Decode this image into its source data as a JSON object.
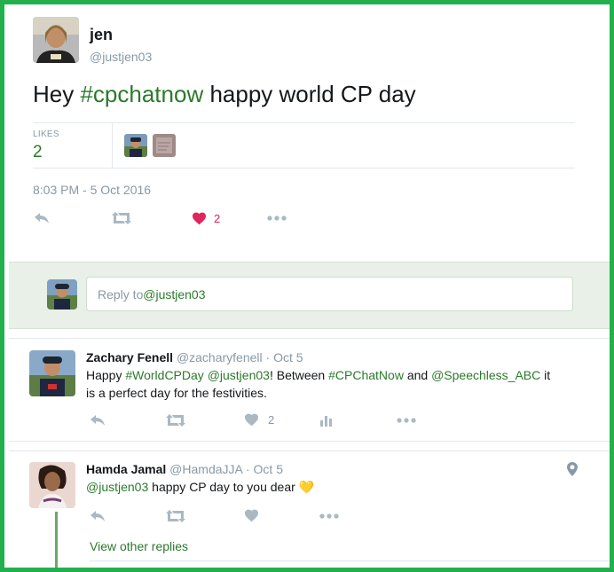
{
  "tweet": {
    "author_name": "jen",
    "author_handle": "@justjen03",
    "text_prefix": "Hey ",
    "hashtag": "#cpchatnow",
    "text_suffix": " happy world CP day",
    "likes_label": "LIKES",
    "likes_count": "2",
    "timestamp": "8:03 PM - 5 Oct 2016",
    "actions": {
      "like_count": "2"
    }
  },
  "reply_box": {
    "prefix": "Reply to ",
    "handle": "@justjen03"
  },
  "replies": [
    {
      "name": "Zachary Fenell",
      "handle": "@zacharyfenell",
      "date": "Oct 5",
      "line1_parts": [
        "Happy ",
        "#WorldCPDay",
        " ",
        "@justjen03",
        "! Between ",
        "#CPChatNow",
        " and ",
        "@Speechless_ABC",
        " it"
      ],
      "line2": "is a perfect day for the festivities.",
      "like_count": "2"
    },
    {
      "name": "Hamda Jamal",
      "handle": "@HamdaJJA",
      "date": "Oct 5",
      "mention": "@justjen03",
      "text": " happy CP day to you dear ",
      "emoji": "💛"
    }
  ],
  "view_other_replies": "View other replies",
  "dot_sep": "·",
  "colors": {
    "border": "#21b04b",
    "link": "#2b7a2b",
    "like": "#e0245e",
    "muted": "#8899a6"
  }
}
